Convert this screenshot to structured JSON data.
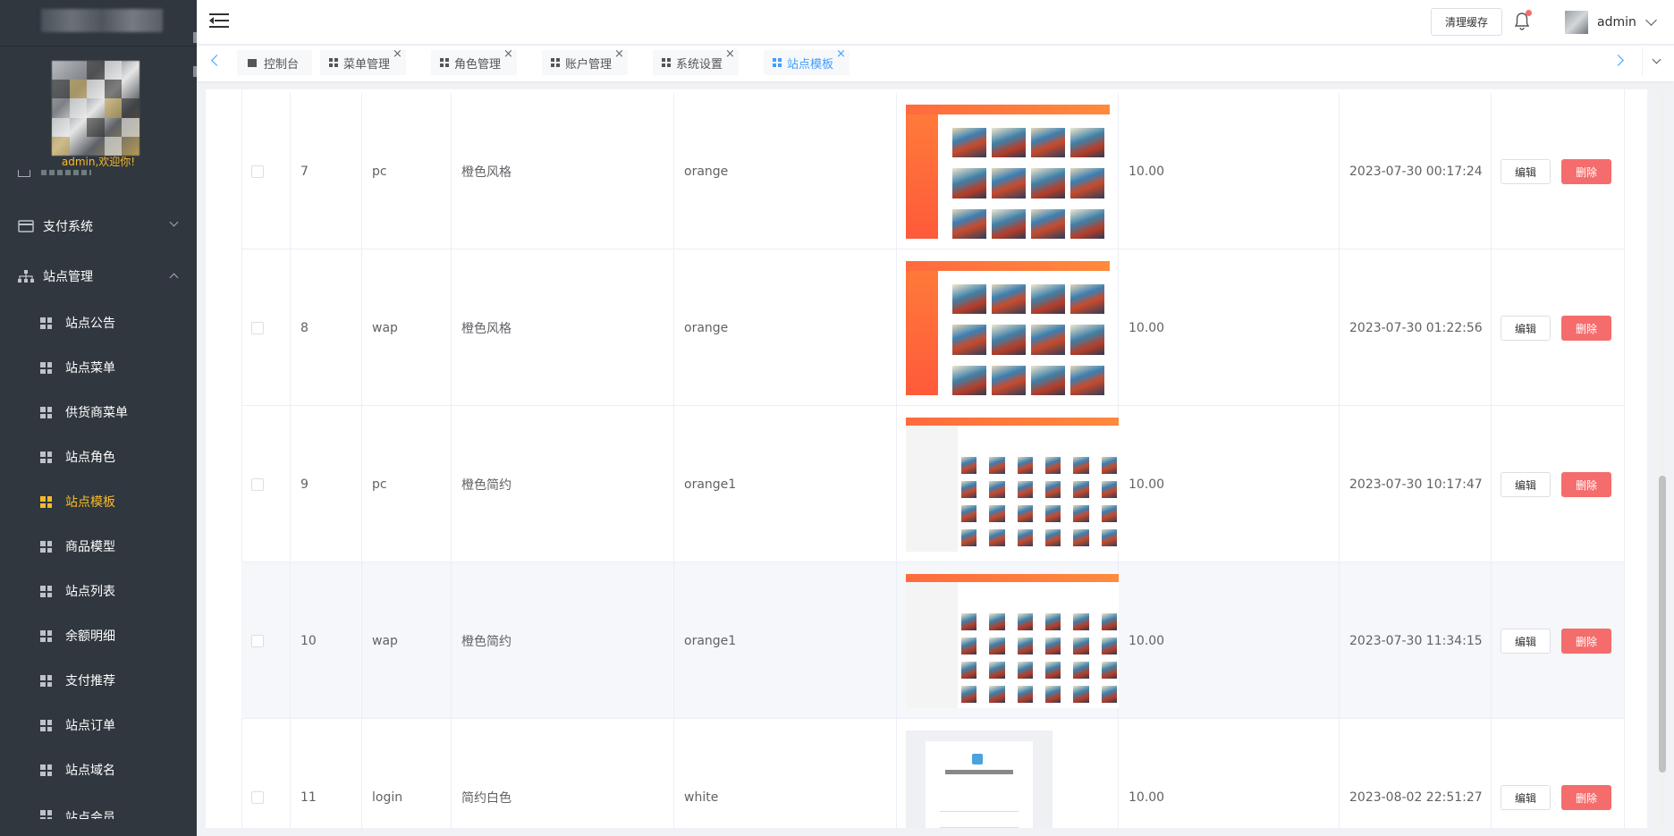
{
  "sidebar": {
    "welcome": "admin,欢迎你!",
    "groups": [
      {
        "label": "支付系统"
      },
      {
        "label": "站点管理"
      }
    ],
    "items": [
      {
        "label": "站点公告"
      },
      {
        "label": "站点菜单"
      },
      {
        "label": "供货商菜单"
      },
      {
        "label": "站点角色"
      },
      {
        "label": "站点模板"
      },
      {
        "label": "商品模型"
      },
      {
        "label": "站点列表"
      },
      {
        "label": "余额明细"
      },
      {
        "label": "支付推荐"
      },
      {
        "label": "站点订单"
      },
      {
        "label": "站点域名"
      },
      {
        "label": "站点会员"
      }
    ]
  },
  "header": {
    "clear_cache": "清理缓存",
    "username": "admin"
  },
  "tabs": [
    {
      "label": "控制台",
      "close": ""
    },
    {
      "label": "菜单管理",
      "close": "×"
    },
    {
      "label": "角色管理",
      "close": "×"
    },
    {
      "label": "账户管理",
      "close": "×"
    },
    {
      "label": "系统设置",
      "close": "×"
    },
    {
      "label": "站点模板",
      "close": "×"
    }
  ],
  "table": {
    "edit_label": "编辑",
    "delete_label": "删除",
    "rows": [
      {
        "id": "7",
        "platform": "pc",
        "name": "橙色风格",
        "code": "orange",
        "price": "10.00",
        "time": "2023-07-30 00:17:24"
      },
      {
        "id": "8",
        "platform": "wap",
        "name": "橙色风格",
        "code": "orange",
        "price": "10.00",
        "time": "2023-07-30 01:22:56"
      },
      {
        "id": "9",
        "platform": "pc",
        "name": "橙色简约",
        "code": "orange1",
        "price": "10.00",
        "time": "2023-07-30 10:17:47"
      },
      {
        "id": "10",
        "platform": "wap",
        "name": "橙色简约",
        "code": "orange1",
        "price": "10.00",
        "time": "2023-07-30 11:34:15"
      },
      {
        "id": "11",
        "platform": "login",
        "name": "简约白色",
        "code": "white",
        "price": "10.00",
        "time": "2023-08-02 22:51:27"
      }
    ]
  },
  "icons": {
    "menu_toggle": "hamburger-icon",
    "bell": "bell-icon",
    "grid": "grid-icon",
    "pay": "card-icon",
    "site": "sitemap-icon"
  },
  "colors": {
    "sidebar_bg": "#30373e",
    "active": "#f7ba2a",
    "primary": "#409eff",
    "danger": "#f56c6c"
  }
}
